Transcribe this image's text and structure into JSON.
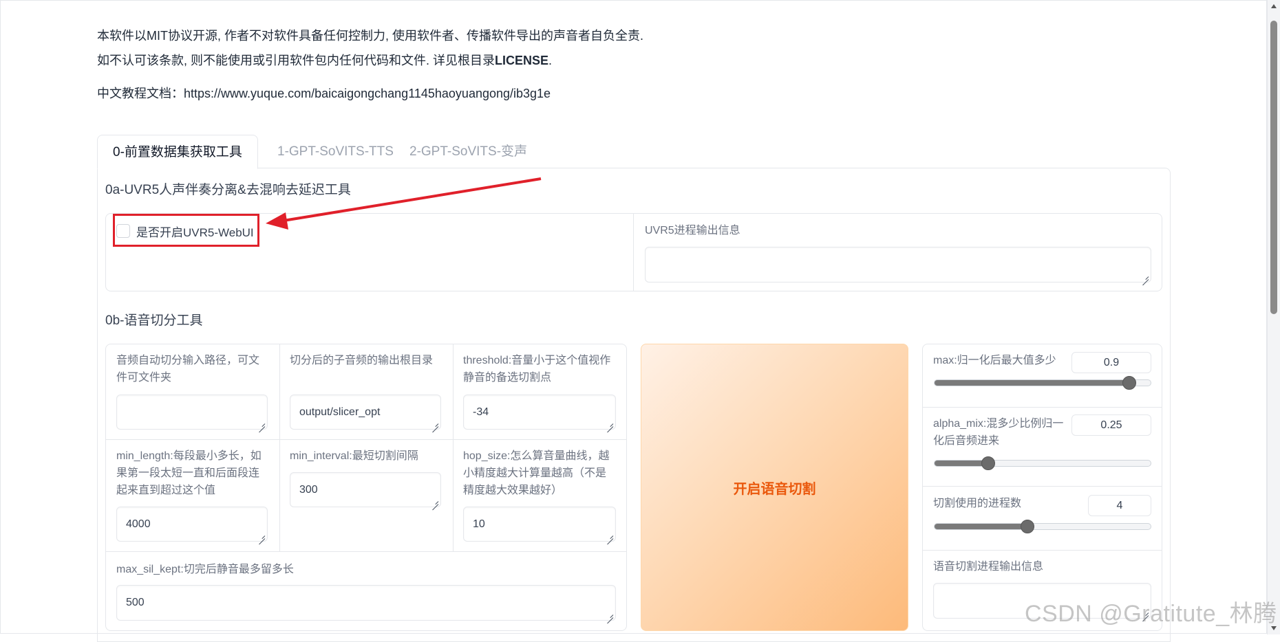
{
  "notice": {
    "line1": "本软件以MIT协议开源, 作者不对软件具备任何控制力, 使用软件者、传播软件导出的声音者自负全责.",
    "line2_prefix": "如不认可该条款, 则不能使用或引用软件包内任何代码和文件. 详见根目录",
    "line2_license": "LICENSE",
    "line2_suffix": "."
  },
  "tutorial": {
    "label": "中文教程文档：",
    "url": "https://www.yuque.com/baicaigongchang1145haoyuangong/ib3g1e"
  },
  "tabs": [
    {
      "label": "0-前置数据集获取工具",
      "active": true
    },
    {
      "label": "1-GPT-SoVITS-TTS",
      "active": false
    },
    {
      "label": "2-GPT-SoVITS-变声",
      "active": false
    }
  ],
  "uvr5": {
    "title": "0a-UVR5人声伴奏分离&去混响去延迟工具",
    "checkbox_label": "是否开启UVR5-WebUI",
    "checked": false,
    "output_label": "UVR5进程输出信息",
    "output_value": ""
  },
  "slicer": {
    "title": "0b-语音切分工具",
    "input_path_label": "音频自动切分输入路径，可文件可文件夹",
    "input_path_value": "",
    "output_dir_label": "切分后的子音频的输出根目录",
    "output_dir_value": "output/slicer_opt",
    "threshold_label": "threshold:音量小于这个值视作静音的备选切割点",
    "threshold_value": "-34",
    "min_length_label": "min_length:每段最小多长，如果第一段太短一直和后面段连起来直到超过这个值",
    "min_length_value": "4000",
    "min_interval_label": "min_interval:最短切割间隔",
    "min_interval_value": "300",
    "hop_size_label": "hop_size:怎么算音量曲线，越小精度越大计算量越高（不是精度越大效果越好）",
    "hop_size_value": "10",
    "max_sil_kept_label": "max_sil_kept:切完后静音最多留多长",
    "max_sil_kept_value": "500",
    "start_button": "开启语音切割",
    "max_label": "max:归一化后最大值多少",
    "max_value": "0.9",
    "max_fraction": 0.9,
    "alpha_label": "alpha_mix:混多少比例归一化后音频进来",
    "alpha_value": "0.25",
    "alpha_fraction": 0.25,
    "procs_label": "切割使用的进程数",
    "procs_value": "4",
    "procs_fraction": 0.43,
    "progress_label": "语音切割进程输出信息",
    "progress_value": ""
  },
  "colors": {
    "accent_orange": "#ea580c",
    "annotation_red": "#e0202a"
  },
  "watermark": "CSDN @Gratitute_林腾"
}
